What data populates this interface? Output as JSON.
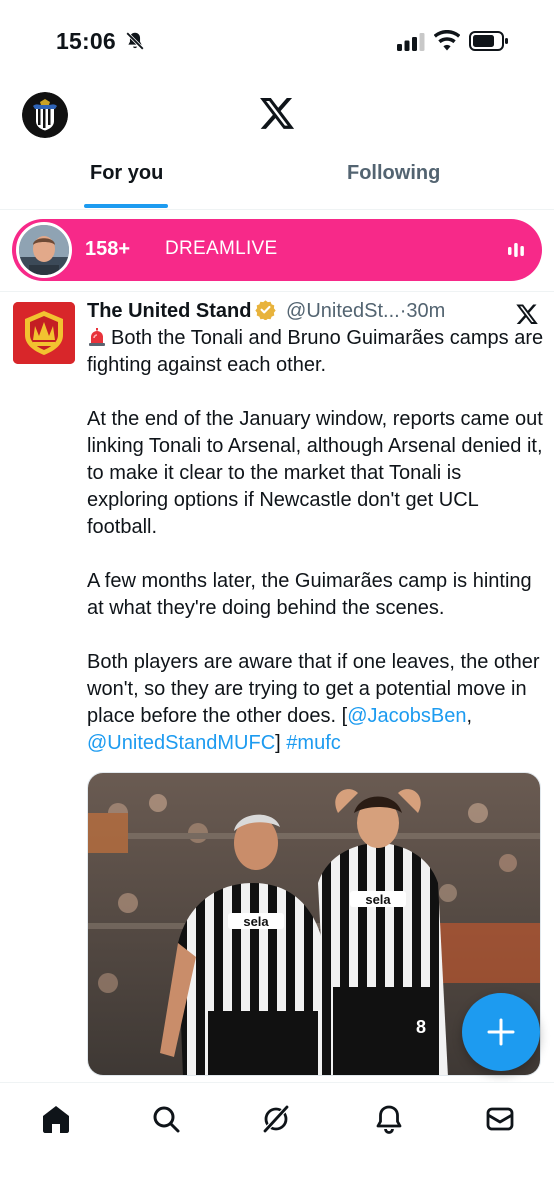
{
  "status_bar": {
    "time": "15:06"
  },
  "header": {
    "tabs": [
      {
        "label": "For you",
        "active": true
      },
      {
        "label": "Following",
        "active": false
      }
    ]
  },
  "live": {
    "count": "158+",
    "name": "DREAMLIVE",
    "color": "#f72989"
  },
  "tweet": {
    "author_name": "The United Stand",
    "handle": "@UnitedSt...",
    "separator": "·",
    "time": "30m",
    "text_line1": "Both the Tonali and Bruno Guimarães camps are fighting against each other.",
    "paragraph2": "At the end of the January window, reports came out linking Tonali to Arsenal, although Arsenal denied it, to make it clear to the market that Tonali is exploring options if Newcastle don't get UCL football.",
    "paragraph3": "A few months later, the Guimarães camp is hinting at what they're doing behind the scenes.",
    "paragraph4": "Both players are aware that if one leaves, the other won't, so they are trying to get a potential move in place before the other does.",
    "open_bracket": "[",
    "mention1": "@JacobsBen",
    "comma": ", ",
    "mention2": "@UnitedStandMUFC",
    "close_bracket": "]",
    "hashtag": "#mufc",
    "media_icons": [
      "photo-of-two-newcastle-players"
    ]
  },
  "colors": {
    "accent": "#1d9bf0",
    "text": "#0f1419",
    "muted": "#536471",
    "verified": "#e8b33c"
  },
  "bottom_nav": {
    "icons": [
      "home-icon",
      "search-icon",
      "grok-icon",
      "notifications-icon",
      "messages-icon"
    ]
  }
}
